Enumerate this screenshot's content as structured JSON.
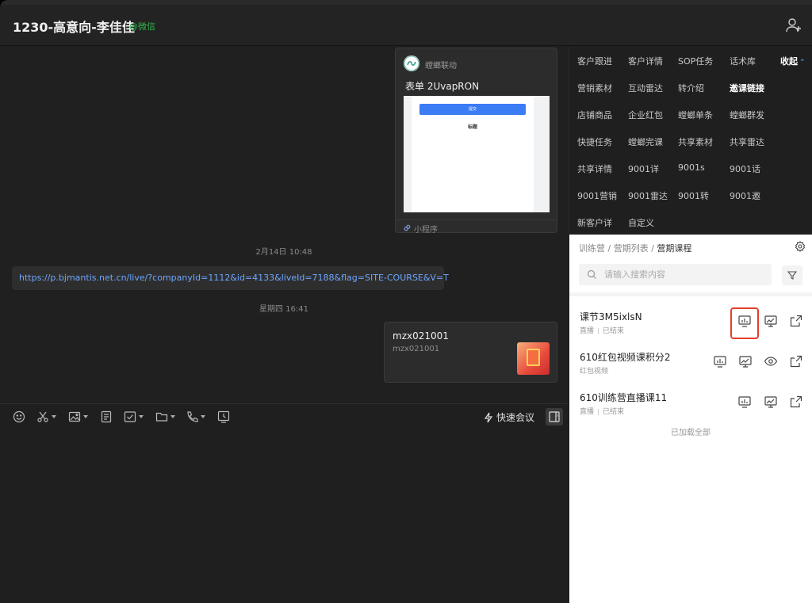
{
  "header": {
    "title": "1230-高意向-李佳佳",
    "channel_tag": "@微信"
  },
  "chat": {
    "mini_program": {
      "app_name": "螳螂联动",
      "title": "表单 2UvapRON",
      "preview_submit": "提交",
      "preview_field": "标题",
      "footer": "小程序"
    },
    "timestamp_1": "2月14日 10:48",
    "link": "https://p.bjmantis.net.cn/live/?companyId=1112&id=4133&liveId=7188&flag=SITE-COURSE&V=T",
    "timestamp_2": "星期四 16:41",
    "contact_card": {
      "name": "mzx021001",
      "id": "mzx021001"
    }
  },
  "toolbar": {
    "quick_meeting": "快速会议"
  },
  "side_nav": {
    "collapse": "收起",
    "rows": [
      [
        "客户跟进",
        "客户详情",
        "SOP任务",
        "话术库"
      ],
      [
        "营销素材",
        "互动雷达",
        "转介绍",
        "邀课链接"
      ],
      [
        "店铺商品",
        "企业红包",
        "螳螂单条",
        "螳螂群发"
      ],
      [
        "快捷任务",
        "螳螂完课",
        "共享素材",
        "共享雷达"
      ],
      [
        "共享详情",
        "9001详",
        "9001s",
        "9001话"
      ],
      [
        "9001营销",
        "9001雷达",
        "9001转",
        "9001邀"
      ],
      [
        "新客户详",
        "自定义"
      ]
    ],
    "active": "邀课链接"
  },
  "panel": {
    "breadcrumb": {
      "level1": "训练营",
      "level2": "营期列表",
      "current": "营期课程"
    },
    "search_placeholder": "请输入搜索内容",
    "courses": [
      {
        "title": "课节3M5ixlsN",
        "type": "直播",
        "status": "已结束"
      },
      {
        "title": "610红包视频课积分2",
        "type": "红包视频",
        "status": ""
      },
      {
        "title": "610训练营直播课11",
        "type": "直播",
        "status": "已结束"
      }
    ],
    "loaded_all": "已加载全部"
  },
  "colors": {
    "background": "#1f1f1f",
    "link": "#6ea6ff",
    "wechat_green": "#2fb24c",
    "highlight_red": "#e2402a",
    "accent_blue": "#3b7cf5"
  }
}
